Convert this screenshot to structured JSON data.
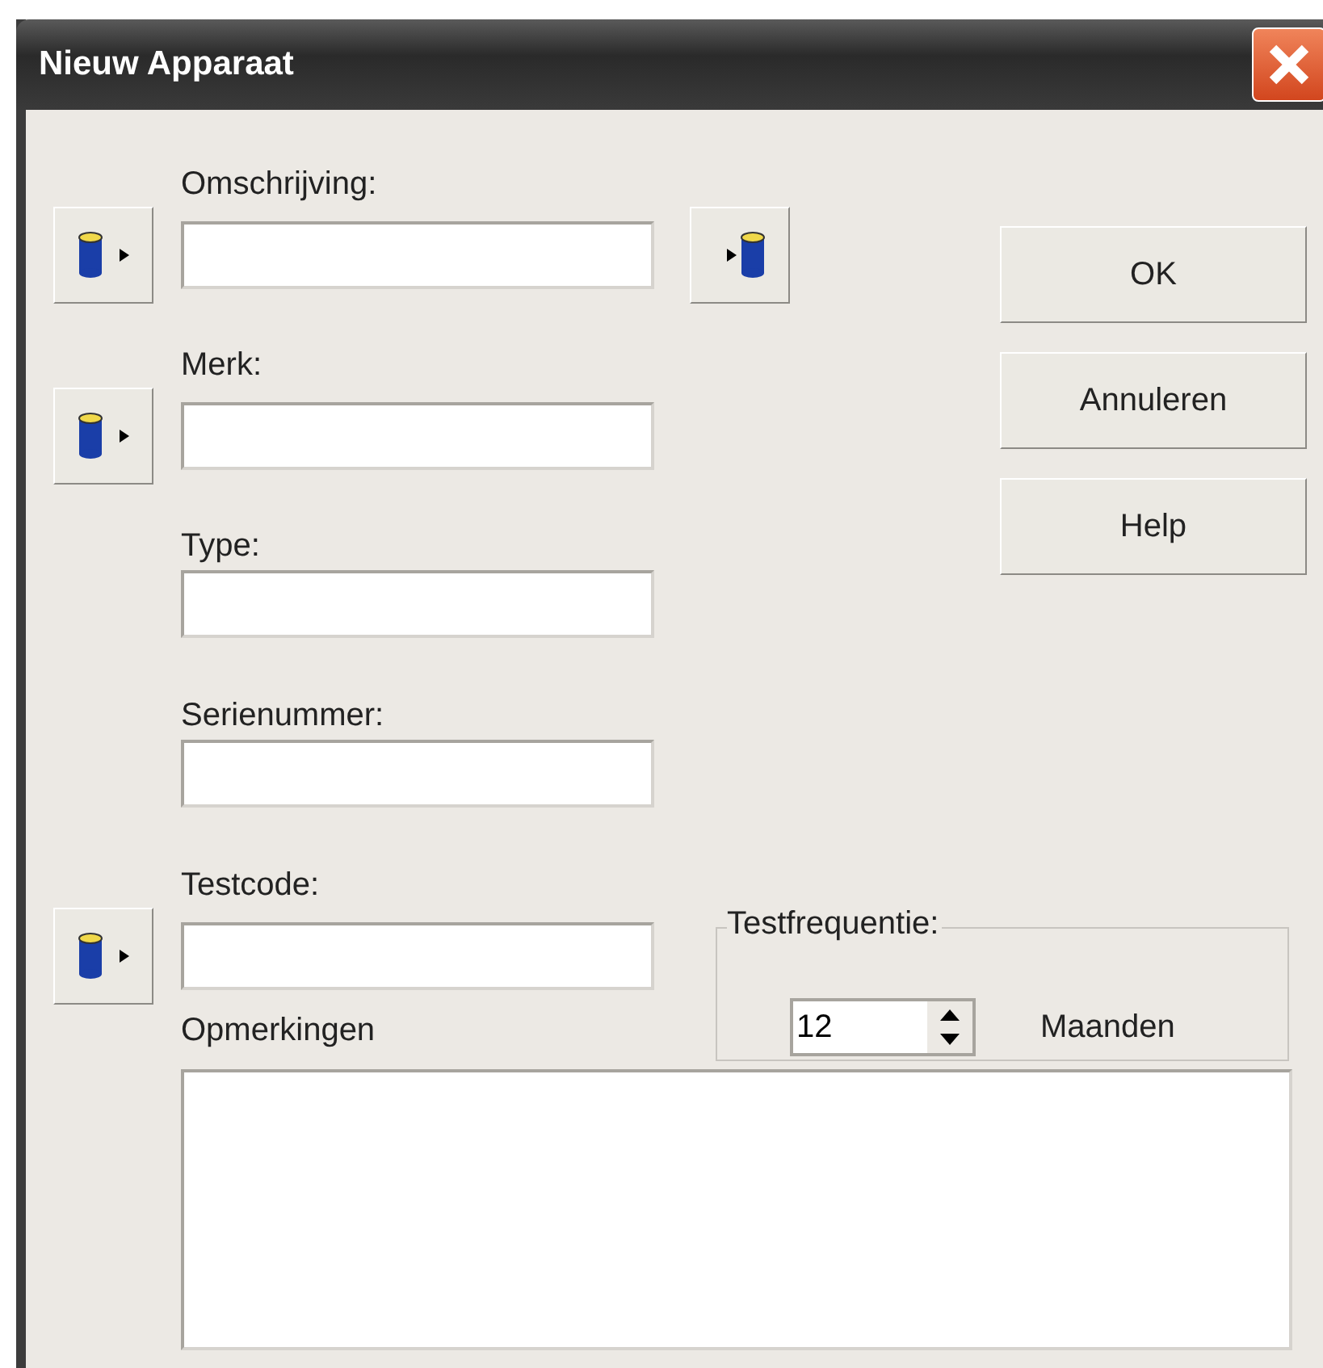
{
  "window": {
    "title": "Nieuw Apparaat"
  },
  "fields": [
    {
      "label": "Omschrijving:",
      "import_button": true,
      "export_button": true
    },
    {
      "label": "Merk:",
      "import_button": true,
      "export_button": false
    },
    {
      "label": "Type:",
      "import_button": false,
      "export_button": false
    },
    {
      "label": "Serienummer:",
      "import_button": false,
      "export_button": false
    }
  ],
  "testcode": {
    "label": "Testcode:",
    "import_button": true
  },
  "buttons": [
    "OK",
    "Annuleren",
    "Help"
  ],
  "testfrequentie": {
    "label": "Testfrequentie:",
    "value": "12",
    "unit": "Maanden"
  },
  "remarks": {
    "label": "Opmerkingen"
  }
}
